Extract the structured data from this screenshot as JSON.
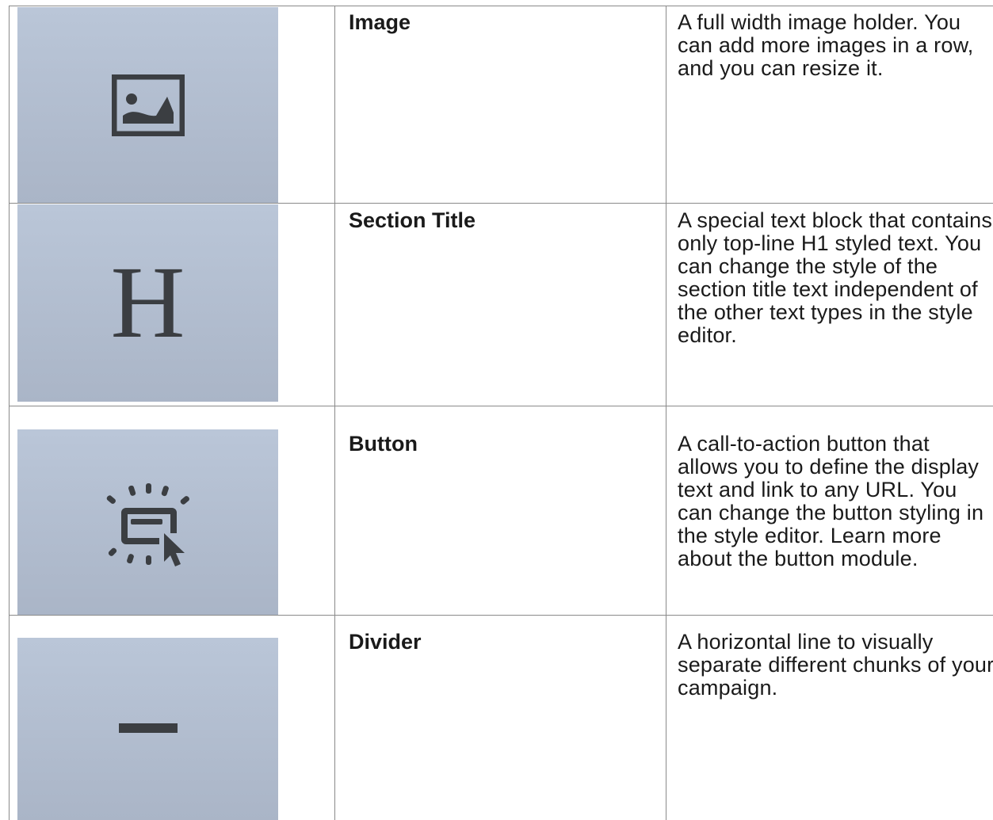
{
  "rows": [
    {
      "icon": "image-icon",
      "title": "Image",
      "description": "A full width image holder. You can add more images in a row, and you can resize it."
    },
    {
      "icon": "heading-icon",
      "icon_text": "H",
      "title": "Section Title",
      "description": "A special text block that contains only top-line H1 styled text. You can change the style of the section title text independent of the other text types in the style editor."
    },
    {
      "icon": "button-click-icon",
      "title": "Button",
      "description": "A call-to-action button that allows you to define the display text and link to any URL. You can change the button styling in the style editor. Learn more about the button module."
    },
    {
      "icon": "divider-icon",
      "title": "Divider",
      "description": "A horizontal line to visually separate different chunks of your campaign."
    }
  ],
  "colors": {
    "thumb_top": "#bac6d8",
    "thumb_bottom": "#aab5c7",
    "icon": "#3b3e42",
    "border": "#8a8a8a"
  }
}
